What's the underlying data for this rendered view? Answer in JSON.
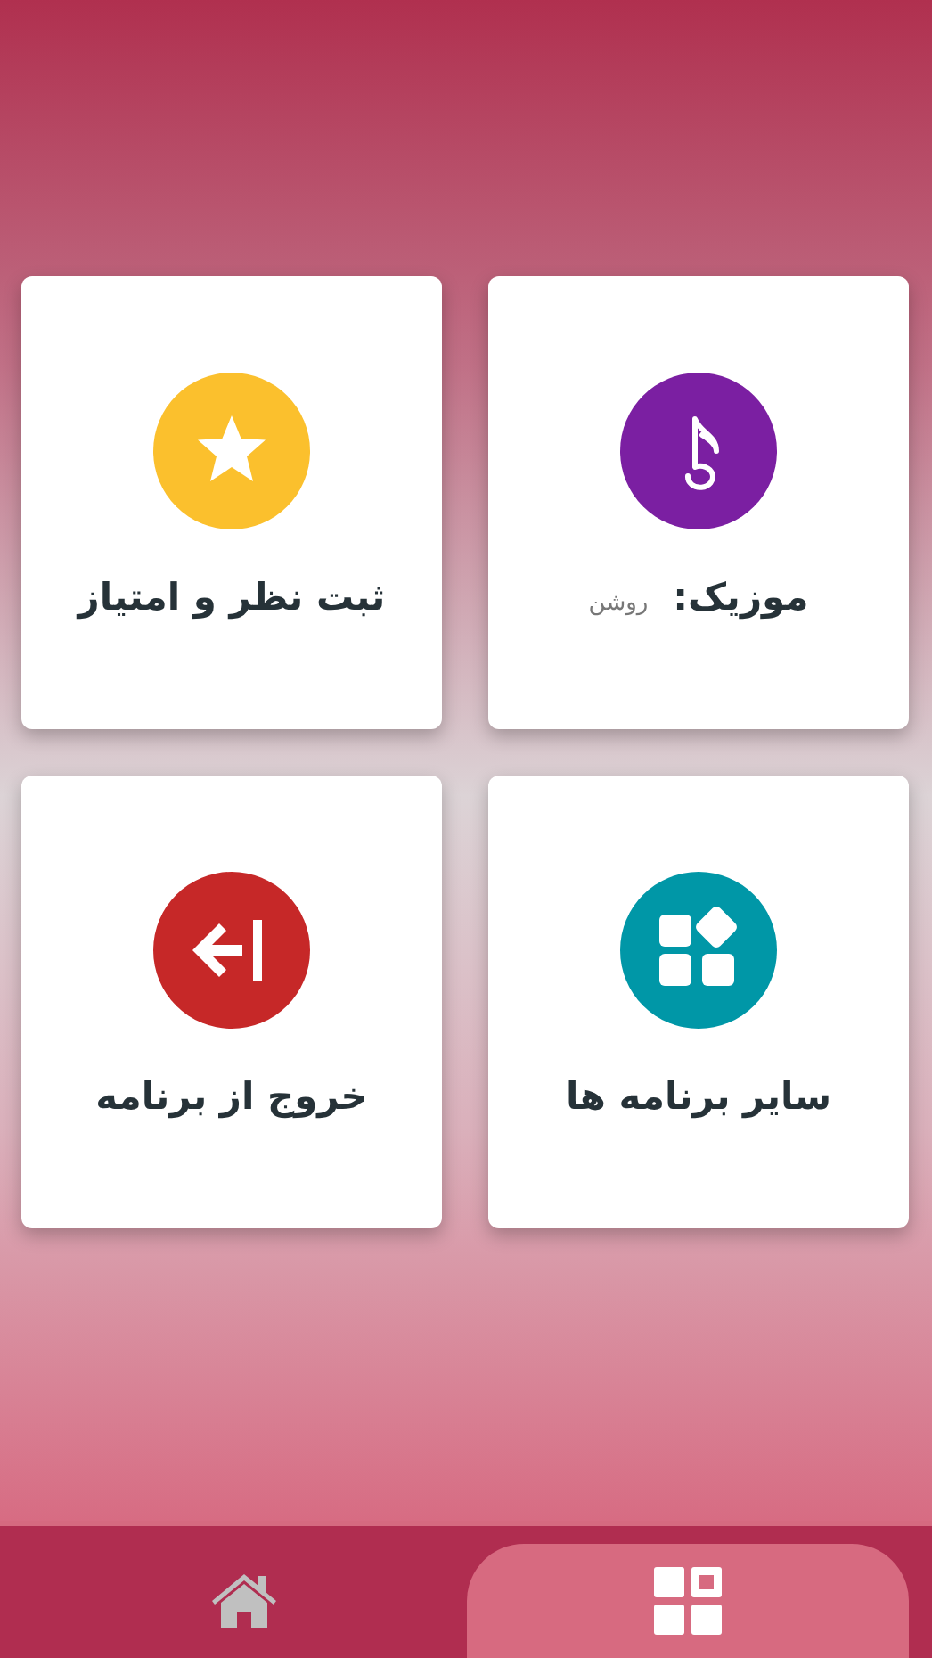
{
  "cards": [
    {
      "kind": "music",
      "label": "موزیک:",
      "status": "روشن",
      "color": "#7b1fa2"
    },
    {
      "kind": "star",
      "label": "ثبت نظر و امتیاز",
      "color": "#fbc02d"
    },
    {
      "kind": "apps",
      "label": "سایر برنامه ها",
      "color": "#0097a7"
    },
    {
      "kind": "exit",
      "label": "خروج از برنامه",
      "color": "#c62828"
    }
  ],
  "bottom_nav": [
    {
      "kind": "apps",
      "selected": true
    },
    {
      "kind": "home",
      "selected": false
    }
  ]
}
